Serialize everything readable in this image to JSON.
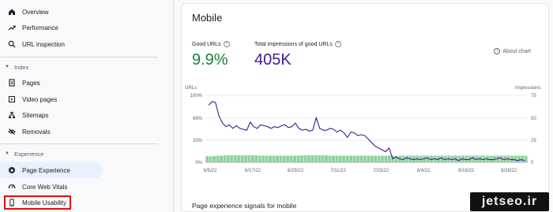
{
  "sidebar": {
    "items_top": [
      {
        "label": "Overview",
        "icon": "home-icon"
      },
      {
        "label": "Performance",
        "icon": "trend-icon"
      },
      {
        "label": "URL inspection",
        "icon": "search-icon"
      }
    ],
    "index": {
      "heading": "Index",
      "items": [
        {
          "label": "Pages",
          "icon": "pages-icon"
        },
        {
          "label": "Video pages",
          "icon": "video-icon"
        },
        {
          "label": "Sitemaps",
          "icon": "sitemap-icon"
        },
        {
          "label": "Removals",
          "icon": "eye-off-icon"
        }
      ]
    },
    "experience": {
      "heading": "Experience",
      "items": [
        {
          "label": "Page Experience",
          "icon": "page-experience-icon",
          "active": true
        },
        {
          "label": "Core Web Vitals",
          "icon": "gauge-icon"
        },
        {
          "label": "Mobile Usability",
          "icon": "phone-icon"
        }
      ]
    }
  },
  "card": {
    "title": "Mobile",
    "good_urls_label": "Good URLs",
    "good_urls_value": "9.9%",
    "impressions_label": "Total impressions of good URLs",
    "impressions_value": "405K",
    "about_chart": "About chart",
    "section_title": "Page experience signals for mobile",
    "colors": {
      "good": "#188038",
      "impressions": "#3c1c8c",
      "bars": "#8fd19e"
    }
  },
  "chart_data": {
    "type": "bar",
    "left_axis_title": "URLs",
    "right_axis_title": "Impressions",
    "left_ticks": [
      "100%",
      "66%",
      "33%",
      "0%"
    ],
    "right_ticks": [
      "75",
      "50",
      "25",
      "0"
    ],
    "x_ticks": [
      "6/5/22",
      "6/17/22",
      "6/29/22",
      "7/11/22",
      "7/23/22",
      "8/4/22",
      "8/16/22",
      "8/28/22"
    ],
    "ylim_left": [
      0,
      100
    ],
    "ylim_right": [
      0,
      75
    ],
    "grid": true,
    "series": [
      {
        "name": "Good URLs",
        "type": "bar",
        "axis": "left",
        "values": [
          9,
          9,
          9.5,
          10,
          10,
          10.5,
          10.5,
          10.5,
          10.5,
          10.5,
          10.5,
          10.5,
          10.5,
          10.5,
          10.5,
          10,
          10,
          10,
          10,
          10,
          10,
          10,
          10,
          10,
          10,
          10,
          10,
          10.5,
          10.5,
          10.5,
          10.5,
          10.5,
          10.5,
          10.5,
          10.5,
          10,
          10,
          10,
          10,
          10,
          10,
          10,
          10,
          10,
          10,
          10,
          10,
          10,
          10,
          10,
          10,
          10,
          10,
          10,
          10,
          10,
          10,
          10,
          10,
          10,
          10,
          10,
          10,
          10,
          10,
          10,
          10,
          10,
          10,
          10,
          10,
          10,
          10,
          10,
          10,
          10,
          10,
          10,
          10,
          10,
          10,
          10,
          10,
          10,
          10,
          10,
          10,
          10,
          10,
          10,
          10,
          9.5
        ]
      },
      {
        "name": "Total impressions of good URLs",
        "type": "line",
        "axis": "right",
        "values": [
          64,
          68,
          67,
          52,
          44,
          40,
          42,
          38,
          41,
          38,
          37,
          36,
          45,
          40,
          38,
          42,
          41,
          40,
          38,
          40,
          39,
          41,
          42,
          39,
          40,
          44,
          38,
          36,
          37,
          35,
          36,
          50,
          38,
          36,
          36,
          38,
          37,
          34,
          36,
          33,
          28,
          34,
          33,
          30,
          31,
          30,
          26,
          22,
          18,
          16,
          14,
          12,
          16,
          4,
          6,
          4,
          3,
          5,
          4,
          3,
          4,
          3,
          4,
          5,
          3,
          4,
          3,
          5,
          3,
          4,
          3,
          4,
          2,
          4,
          3,
          3,
          5,
          3,
          4,
          3,
          4,
          3,
          3,
          4,
          5,
          3,
          4,
          3,
          3,
          2,
          3,
          2
        ]
      }
    ]
  },
  "watermark": "jetseo.ir"
}
